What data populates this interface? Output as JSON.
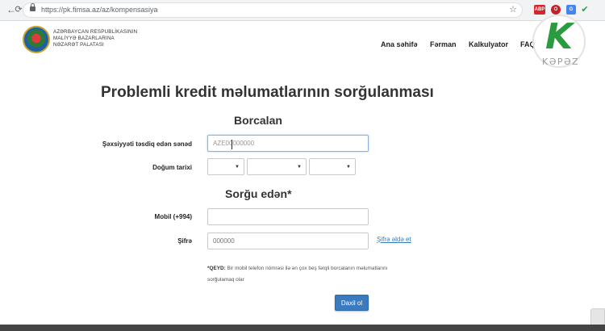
{
  "browser": {
    "url": "https://pk.fimsa.az/az/kompensasiya",
    "extensions": [
      {
        "name": "adblock",
        "label": "ABP",
        "color": "#d7262b"
      },
      {
        "name": "opera",
        "label": "O",
        "color": "#c4222a"
      },
      {
        "name": "translate",
        "label": "G",
        "color": "#4285f4"
      },
      {
        "name": "check",
        "label": "✔",
        "color": "#2a9b3e"
      }
    ]
  },
  "site": {
    "org_name_lines": [
      "AZƏRBAYCAN RESPUBLİKASININ",
      "MALİYYƏ BAZARLARINA",
      "NƏZARƏT PALATASI"
    ],
    "nav": [
      "Ana səhifə",
      "Fərman",
      "Kalkulyator",
      "FAQ"
    ]
  },
  "watermark": {
    "letter": "K",
    "name": "KƏPƏZ"
  },
  "form": {
    "title": "Problemli kredit məlumatlarının sorğulanması",
    "borrower_section": "Borcalan",
    "id_label": "Şəxsiyyəti təsdiq edən sənəd",
    "id_value": "AZE00000000",
    "dob_label": "Doğum tarixi",
    "requester_section": "Sorğu edən*",
    "mobile_label": "Mobil (+994)",
    "mobile_value": "",
    "password_label": "Şifrə",
    "password_placeholder": "000000",
    "get_password_link": "Şifrə əldə et",
    "note_title": "*QEYD:",
    "note_text": " Bir mobil telefon nömrəsi ilə ən çox beş fərqli borcalanın məlumatlarını sorğulamaq olar",
    "submit_label": "Daxil ol"
  }
}
